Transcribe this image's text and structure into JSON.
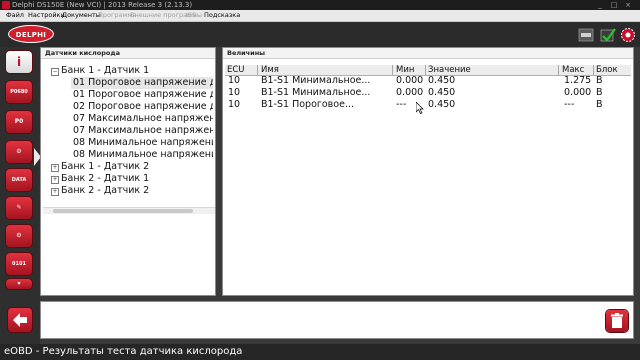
{
  "window": {
    "title": "Delphi DS150E (New VCI) | 2013 Release 3 (2.13.3)",
    "controls": [
      "_",
      "□",
      "×"
    ]
  },
  "menu": {
    "items": [
      {
        "label": "Файл",
        "enabled": true
      },
      {
        "label": "Настройки",
        "enabled": true
      },
      {
        "label": "Документы",
        "enabled": true
      },
      {
        "label": "Программа",
        "enabled": false
      },
      {
        "label": "Внешние программы",
        "enabled": false
      },
      {
        "label": "ISS",
        "enabled": false
      },
      {
        "label": "Подсказка",
        "enabled": true
      }
    ]
  },
  "header": {
    "logo_text": "DELPHI",
    "right_icons": [
      "eobd-mode-icon",
      "connection-check-icon",
      "vci-status-icon"
    ]
  },
  "sidebar": {
    "buttons": [
      {
        "name": "info-icon",
        "label": "i"
      },
      {
        "name": "read-codes-icon",
        "label": "P0680"
      },
      {
        "name": "clear-codes-icon",
        "label": "P0"
      },
      {
        "name": "freeze-frame-icon",
        "label": "⚙"
      },
      {
        "name": "live-data-icon",
        "label": "DATA"
      },
      {
        "name": "oxygen-sensor-icon",
        "label": "✎"
      },
      {
        "name": "component-test-icon",
        "label": "⚙"
      },
      {
        "name": "obd-info-icon",
        "label": "0101"
      },
      {
        "name": "scroll-down-icon",
        "label": "▾"
      }
    ]
  },
  "tree": {
    "header": "Датчики кислорода",
    "rows": [
      {
        "label": "Банк 1 - Датчик 1",
        "level": 0,
        "expander": "−",
        "selected": false
      },
      {
        "label": "01 Пороговое напряжение датчика",
        "level": 1,
        "expander": "",
        "selected": true
      },
      {
        "label": "01 Пороговое напряжение датчика",
        "level": 1,
        "expander": "",
        "selected": false
      },
      {
        "label": "02 Пороговое напряжение датчика",
        "level": 1,
        "expander": "",
        "selected": false
      },
      {
        "label": "07 Максимальное напряжение датчика",
        "level": 1,
        "expander": "",
        "selected": false
      },
      {
        "label": "07 Максимальное напряжение датчика",
        "level": 1,
        "expander": "",
        "selected": false
      },
      {
        "label": "08 Минимальное напряжение датчика",
        "level": 1,
        "expander": "",
        "selected": false
      },
      {
        "label": "08 Минимальное напряжение датчика",
        "level": 1,
        "expander": "",
        "selected": false
      },
      {
        "label": "Банк 1 - Датчик 2",
        "level": 0,
        "expander": "+",
        "selected": false
      },
      {
        "label": "Банк 2 - Датчик 1",
        "level": 0,
        "expander": "+",
        "selected": false
      },
      {
        "label": "Банк 2 - Датчик 2",
        "level": 0,
        "expander": "+",
        "selected": false
      }
    ]
  },
  "values": {
    "header": "Величины",
    "columns": [
      "ECU",
      "Имя",
      "Мин",
      "Значение",
      "Макс",
      "Блок"
    ],
    "rows": [
      [
        "10",
        "B1-S1  Минимальное...",
        "0.000",
        "0.450",
        "1.275",
        "B"
      ],
      [
        "10",
        "B1-S1  Минимальное...",
        "0.000",
        "0.450",
        "0.000",
        "B"
      ],
      [
        "10",
        "B1-S1  Пороговое...",
        "---",
        "0.450",
        "---",
        "B"
      ]
    ]
  },
  "bottom": {
    "back_icon": "back-arrow-icon",
    "trash_icon": "trash-icon"
  },
  "status": {
    "text": "eOBD - Результаты теста датчика кислорода"
  },
  "colors": {
    "brand_red": "#c8102e",
    "dark_bg": "#2b2b2b"
  }
}
